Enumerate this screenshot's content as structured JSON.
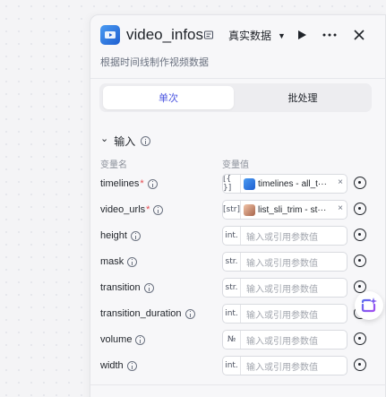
{
  "node": {
    "title": "video_infos",
    "subtitle": "根据时间线制作视频数据",
    "mode_label": "真实数据",
    "mode_caret": "▼",
    "run_icon": "play-icon",
    "more_icon": "more-icon",
    "close_icon": "close-icon"
  },
  "tabs": [
    {
      "label": "单次",
      "active": true
    },
    {
      "label": "批处理",
      "active": false
    }
  ],
  "section": {
    "title": "输入",
    "chevron": "⌄",
    "col_name": "变量名",
    "col_value": "变量值"
  },
  "params": [
    {
      "name": "timelines",
      "required": "*",
      "type": "[{ }]",
      "ref_prefix": "timelines -",
      "ref_value": "all_t···",
      "clear": "×"
    },
    {
      "name": "video_urls",
      "required": "*",
      "type": "[str]",
      "ref_prefix": "list_sli_trim -",
      "ref_value": "st···",
      "clear": "×"
    },
    {
      "name": "height",
      "type": "int.",
      "placeholder": "输入或引用参数值"
    },
    {
      "name": "mask",
      "type": "str.",
      "placeholder": "输入或引用参数值"
    },
    {
      "name": "transition",
      "type": "str.",
      "placeholder": "输入或引用参数值"
    },
    {
      "name": "transition_duration",
      "type": "int.",
      "placeholder": "输入或引用参数值"
    },
    {
      "name": "volume",
      "type": "№",
      "placeholder": "输入或引用参数值"
    },
    {
      "name": "width",
      "type": "int.",
      "placeholder": "输入或引用参数值"
    }
  ],
  "colors": {
    "accent": "#4b55e0",
    "required": "#e5484d"
  }
}
